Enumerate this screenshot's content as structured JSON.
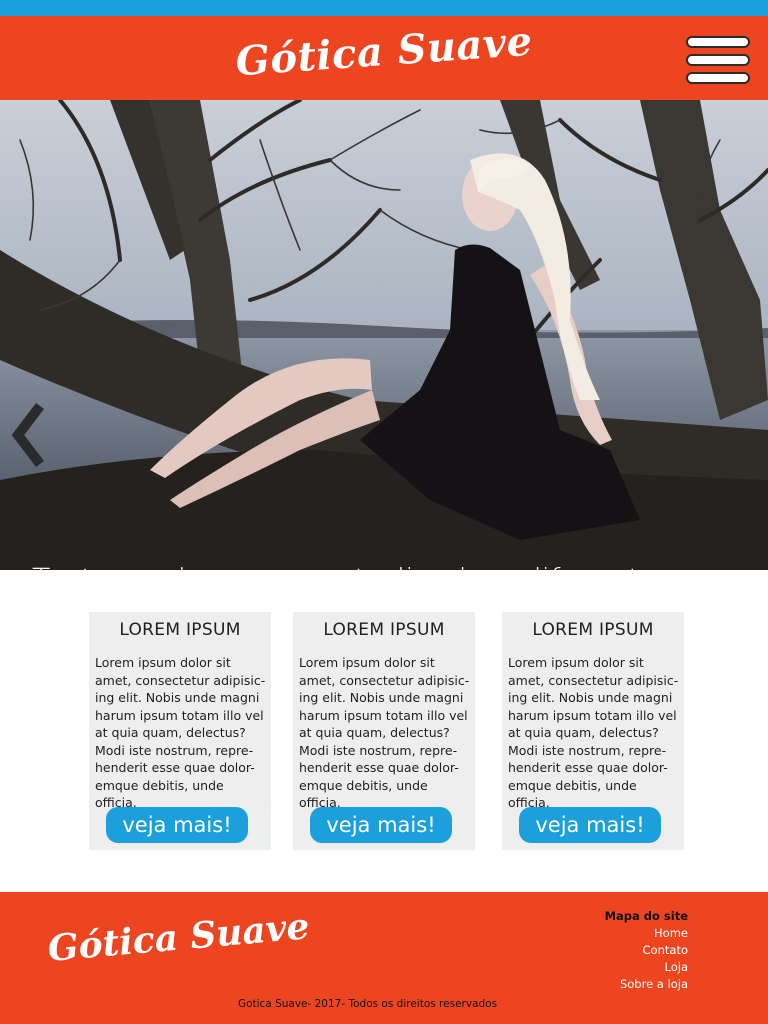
{
  "header": {
    "logo": "Gótica Suave",
    "menu_icon": "hamburger-icon"
  },
  "hero": {
    "caption": "Texto em branco, centralizado e diferente para cada imagem.",
    "prev_icon": "chevron-left-icon"
  },
  "cards": [
    {
      "title": "LOREM IPSUM",
      "body": "Lorem ipsum dolor sit amet, consectetur adipisic-ing elit. Nobis unde magni harum ipsum totam illo vel at quia quam, delectus? Modi iste nostrum, repre-henderit esse quae dolor-emque debitis, unde officia.",
      "button": "veja mais!"
    },
    {
      "title": "LOREM IPSUM",
      "body": "Lorem ipsum dolor sit amet, consectetur adipisic-ing elit. Nobis unde magni harum ipsum totam illo vel at quia quam, delectus? Modi iste nostrum, repre-henderit esse quae dolor-emque debitis, unde officia.",
      "button": "veja mais!"
    },
    {
      "title": "LOREM IPSUM",
      "body": "Lorem ipsum dolor sit amet, consectetur adipisic-ing elit. Nobis unde magni harum ipsum totam illo vel at quia quam, delectus? Modi iste nostrum, repre-henderit esse quae dolor-emque debitis, unde officia.",
      "button": "veja mais!"
    }
  ],
  "footer": {
    "logo": "Gótica Suave",
    "sitemap_title": "Mapa do site",
    "links": [
      "Home",
      "Contato",
      "Loja",
      "Sobre a loja"
    ],
    "copyright": "Gotica Suave- 2017- Todos os direitos reservados"
  },
  "colors": {
    "accent_orange": "#ee4521",
    "accent_blue": "#1ba0db",
    "card_bg": "#eeeeef"
  }
}
